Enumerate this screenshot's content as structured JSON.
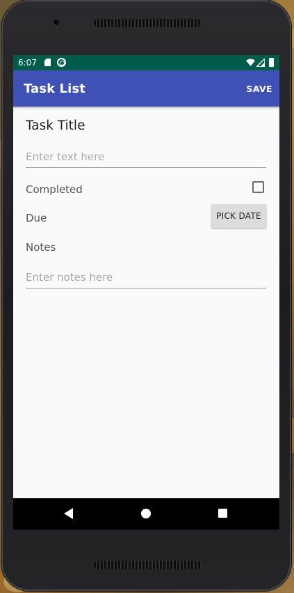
{
  "status_bar": {
    "time": "6:07",
    "icons": [
      "sd-card-icon",
      "sync-icon",
      "wifi-icon",
      "signal-icon",
      "battery-icon"
    ]
  },
  "app_bar": {
    "title": "Task List",
    "save_label": "SAVE",
    "color": "#3f51b5"
  },
  "form": {
    "task_title_label": "Task Title",
    "title_input": {
      "value": "",
      "placeholder": "Enter text here"
    },
    "completed_label": "Completed",
    "completed_checked": false,
    "due_label": "Due",
    "pick_date_label": "PICK DATE",
    "notes_label": "Notes",
    "notes_input": {
      "value": "",
      "placeholder": "Enter notes here"
    }
  },
  "nav_bar": {
    "buttons": [
      "back-icon",
      "home-icon",
      "recents-icon"
    ]
  },
  "colors": {
    "status_bar": "#015b4b",
    "app_bar": "#3f51b5",
    "screen_bg": "#fafafa"
  }
}
